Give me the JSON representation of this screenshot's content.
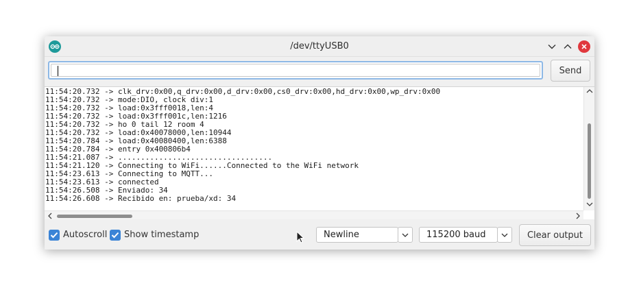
{
  "window": {
    "title": "/dev/ttyUSB0"
  },
  "input": {
    "value": "",
    "send_label": "Send"
  },
  "console": {
    "lines": [
      "11:54:20.732 -> clk_drv:0x00,q_drv:0x00,d_drv:0x00,cs0_drv:0x00,hd_drv:0x00,wp_drv:0x00",
      "11:54:20.732 -> mode:DIO, clock div:1",
      "11:54:20.732 -> load:0x3fff0018,len:4",
      "11:54:20.732 -> load:0x3fff001c,len:1216",
      "11:54:20.732 -> ho 0 tail 12 room 4",
      "11:54:20.732 -> load:0x40078000,len:10944",
      "11:54:20.784 -> load:0x40080400,len:6388",
      "11:54:20.784 -> entry 0x400806b4",
      "11:54:21.087 -> ..................................",
      "11:54:21.120 -> Connecting to WiFi......Connected to the WiFi network",
      "11:54:23.613 -> Connecting to MQTT...",
      "11:54:23.613 -> connected",
      "11:54:26.508 -> Enviado: 34",
      "11:54:26.608 -> Recibido en: prueba/xd: 34"
    ]
  },
  "bottom": {
    "autoscroll": {
      "label": "Autoscroll",
      "checked": true
    },
    "timestamp": {
      "label": "Show timestamp",
      "checked": true
    },
    "line_ending": "Newline",
    "baud": "115200 baud",
    "clear_label": "Clear output"
  },
  "colors": {
    "accent": "#3b84d6",
    "close": "#e0383d",
    "app_icon": "#1e9a9a"
  }
}
